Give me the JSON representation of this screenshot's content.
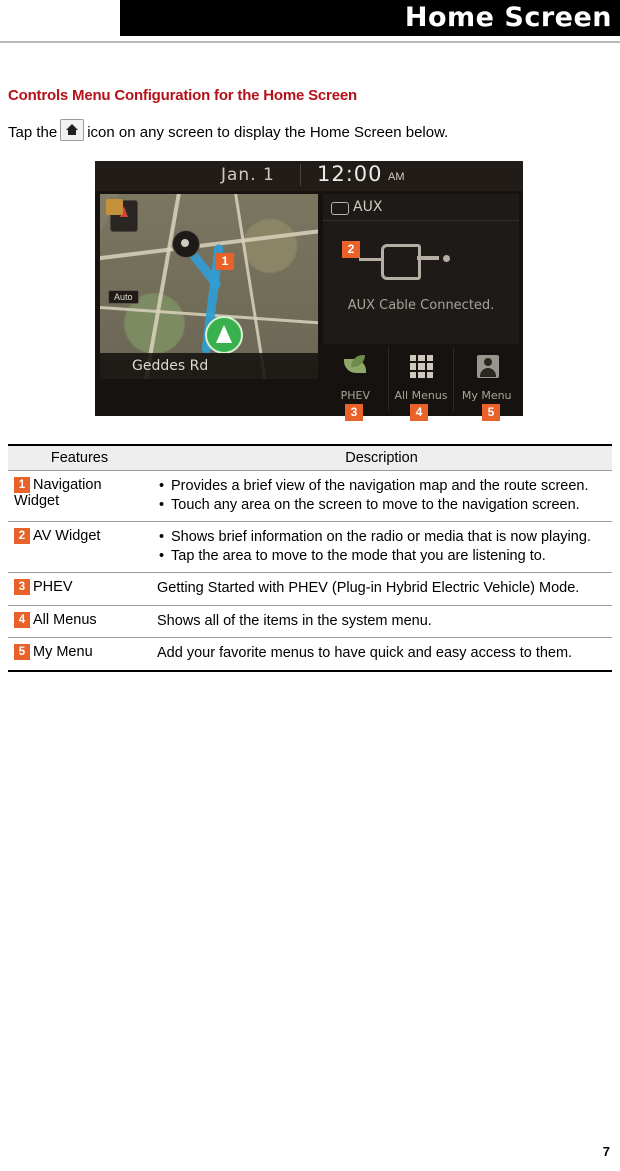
{
  "header": {
    "title": "Home Screen"
  },
  "section": {
    "title": "Controls Menu Configuration for the Home Screen",
    "intro_before": "Tap the",
    "intro_after": "icon on any screen to display the Home Screen below."
  },
  "screen_mock": {
    "status": {
      "date": "Jan.  1",
      "time": "12:00",
      "ampm": "AM"
    },
    "map": {
      "auto_label": "Auto",
      "street": "Geddes Rd"
    },
    "aux": {
      "title": "AUX",
      "caption": "AUX Cable Connected."
    },
    "buttons": [
      {
        "label": "PHEV",
        "icon": "leaf-icon"
      },
      {
        "label": "All Menus",
        "icon": "grid-icon"
      },
      {
        "label": "My Menu",
        "icon": "person-icon"
      }
    ],
    "callouts": [
      "1",
      "2",
      "3",
      "4",
      "5"
    ]
  },
  "table": {
    "headers": [
      "Features",
      "Description"
    ],
    "rows": [
      {
        "num": "1",
        "feature": "Navigation Widget",
        "bullets": [
          "Provides a brief view of the navigation map and the route screen.",
          "Touch any area on the screen to move to the navigation screen."
        ]
      },
      {
        "num": "2",
        "feature": "AV Widget",
        "bullets": [
          "Shows brief information on the radio or media that is now playing.",
          "Tap the area to move to the mode that you are listening to."
        ]
      },
      {
        "num": "3",
        "feature": "PHEV",
        "text": "Getting Started with PHEV (Plug-in Hybrid Electric Vehicle) Mode."
      },
      {
        "num": "4",
        "feature": "All Menus",
        "text": "Shows all of the items in the system menu."
      },
      {
        "num": "5",
        "feature": "My Menu",
        "text": "Add your favorite menus to have quick and easy access to them."
      }
    ]
  },
  "footer": {
    "page_number": "7"
  },
  "colors": {
    "accent_red": "#b4111a",
    "callout_orange": "#e8622a"
  }
}
